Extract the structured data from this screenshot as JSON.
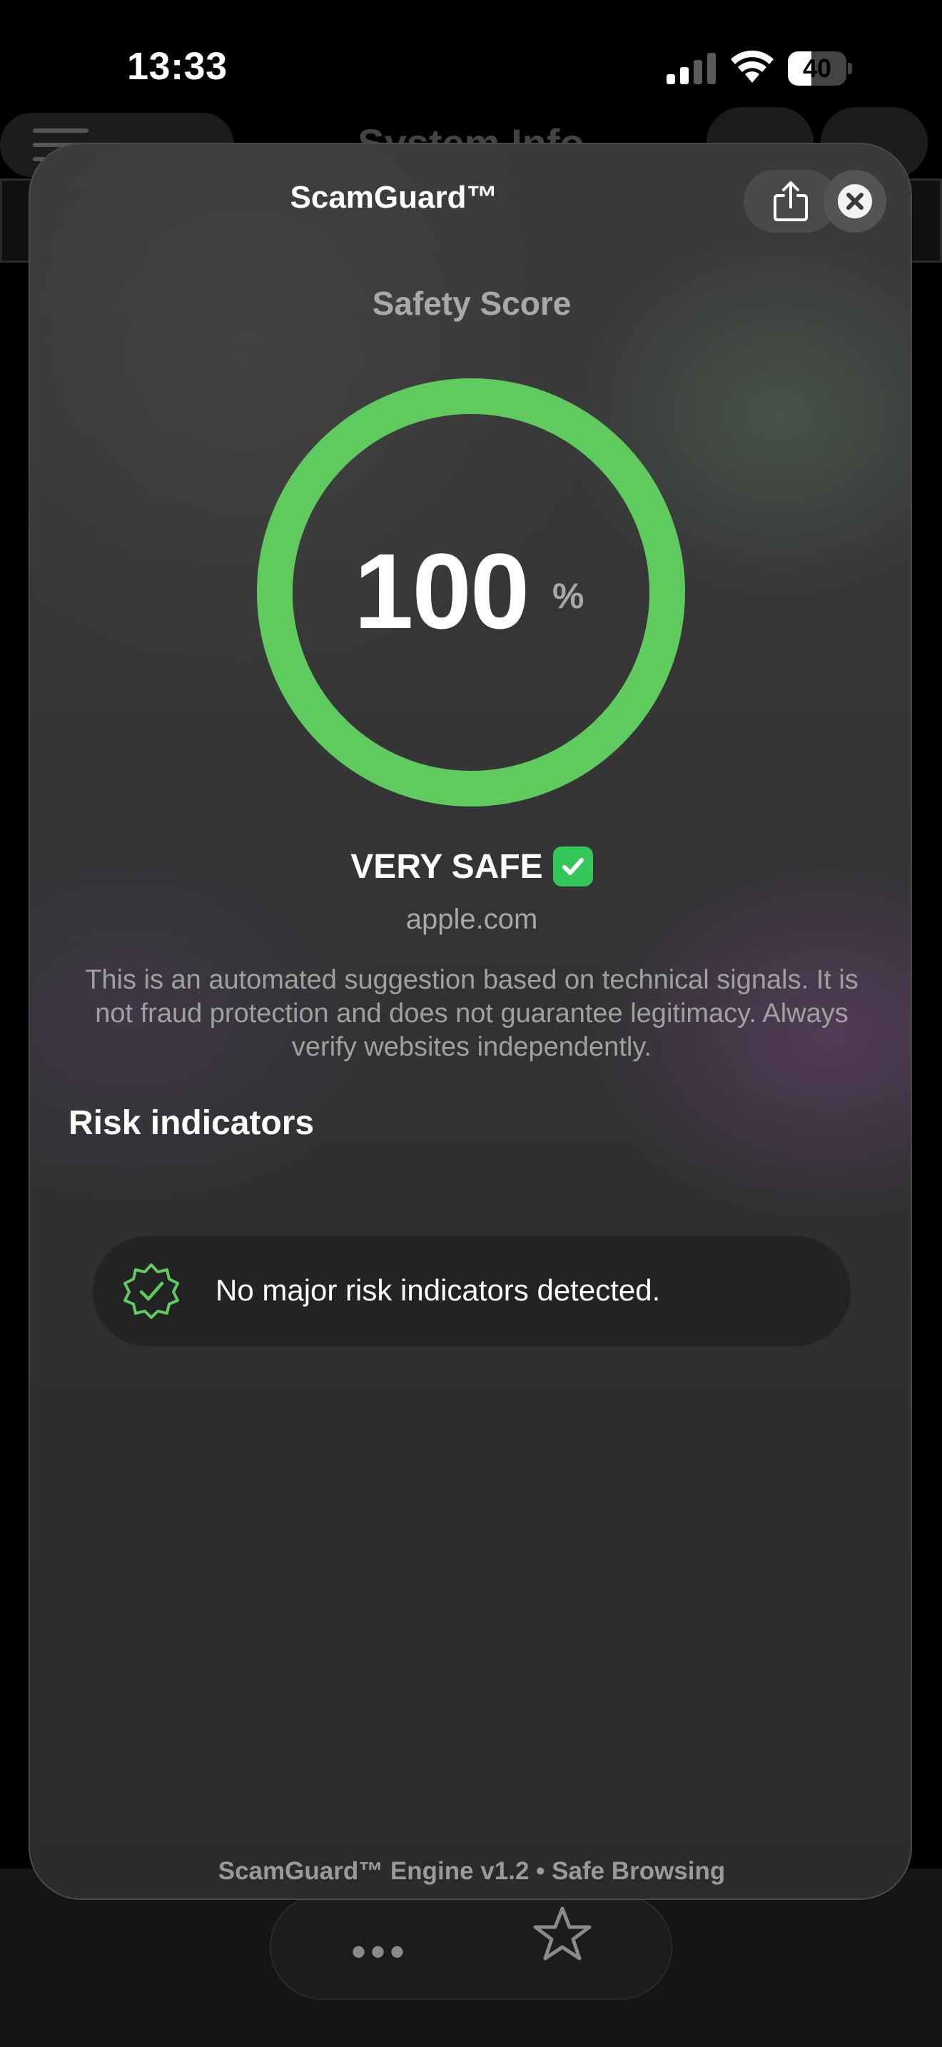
{
  "status_bar": {
    "time": "13:33",
    "battery": "40",
    "battery_level": 0.4
  },
  "background_app": {
    "title": "System Info"
  },
  "sheet": {
    "title": "ScamGuard™",
    "score_label": "Safety Score",
    "score_value": "100",
    "score_unit": "%",
    "score_fraction": 1.0,
    "verdict": "VERY SAFE",
    "domain": "apple.com",
    "disclaimer": "This is an automated suggestion based on technical signals. It is not fraud protection and does not guarantee legitimacy. Always verify websites independently.",
    "risk_heading": "Risk indicators",
    "risk_items": [
      {
        "text": "No major risk indicators detected."
      }
    ],
    "footer": "ScamGuard™ Engine v1.2 • Safe Browsing"
  },
  "colors": {
    "accent_green": "#5fcb5f",
    "check_green": "#34c759"
  },
  "icons": {
    "share": "share-icon",
    "close": "close-icon",
    "verified": "verified-badge-icon",
    "checkmark": "checkmark-icon",
    "more": "more-icon",
    "favorite": "star-icon"
  }
}
